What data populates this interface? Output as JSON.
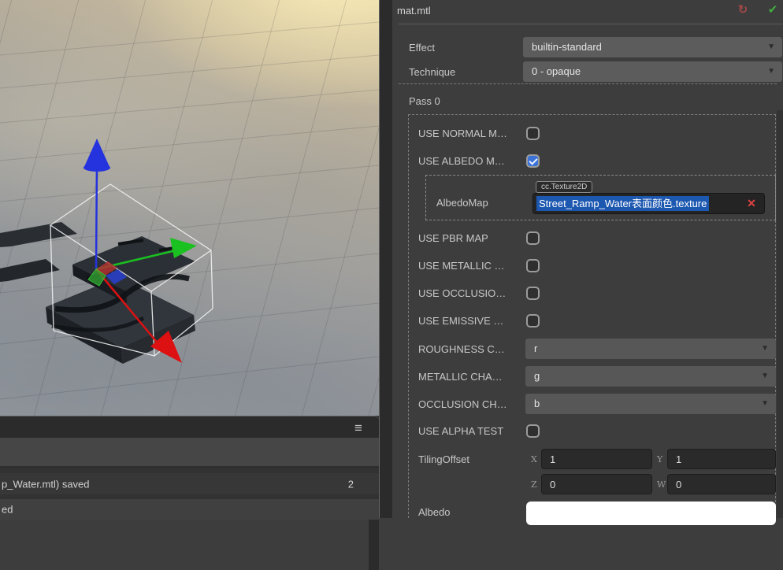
{
  "icons": {
    "menu": "≡",
    "refresh": "↻",
    "confirm": "✔",
    "remove": "✕",
    "dropdown_arrow": "▼"
  },
  "viewport": {
    "gizmo": {
      "up_arrow_color": "#2433dd",
      "right_arrow_color": "#1bc021",
      "forward_arrow_color": "#dd1111"
    },
    "selection_box_color": "#e8e8e8"
  },
  "console": {
    "logs": [
      {
        "text": "p_Water.mtl) saved",
        "count": "2"
      },
      {
        "text": "ed",
        "count": ""
      }
    ]
  },
  "inspector": {
    "title": "mat.mtl",
    "effect": {
      "label": "Effect",
      "value": "builtin-standard"
    },
    "technique": {
      "label": "Technique",
      "value": "0 - opaque"
    },
    "pass_title": "Pass 0",
    "rows": {
      "use_normal": {
        "label": "USE NORMAL M…",
        "checked": false
      },
      "use_albedo": {
        "label": "USE ALBEDO M…",
        "checked": true
      },
      "albedo_map": {
        "label": "AlbedoMap",
        "type_tag": "cc.Texture2D",
        "value": "Street_Ramp_Water表面颜色.texture"
      },
      "use_pbr": {
        "label": "USE PBR MAP",
        "checked": false
      },
      "use_metallic": {
        "label": "USE METALLIC …",
        "checked": false
      },
      "use_occlusion": {
        "label": "USE OCCLUSIO…",
        "checked": false
      },
      "use_emissive": {
        "label": "USE EMISSIVE …",
        "checked": false
      },
      "roughness_channel": {
        "label": "ROUGHNESS C…",
        "value": "r"
      },
      "metallic_channel": {
        "label": "METALLIC CHA…",
        "value": "g"
      },
      "occlusion_channel": {
        "label": "OCCLUSION CH…",
        "value": "b"
      },
      "use_alpha_test": {
        "label": "USE ALPHA TEST",
        "checked": false
      },
      "tiling_offset": {
        "label": "TilingOffset",
        "x_label": "X",
        "y_label": "Y",
        "z_label": "Z",
        "w_label": "W",
        "x": "1",
        "y": "1",
        "z": "0",
        "w": "0"
      },
      "albedo": {
        "label": "Albedo",
        "color": "#ffffff"
      }
    },
    "selection_highlight_color": "#1c57b0"
  }
}
